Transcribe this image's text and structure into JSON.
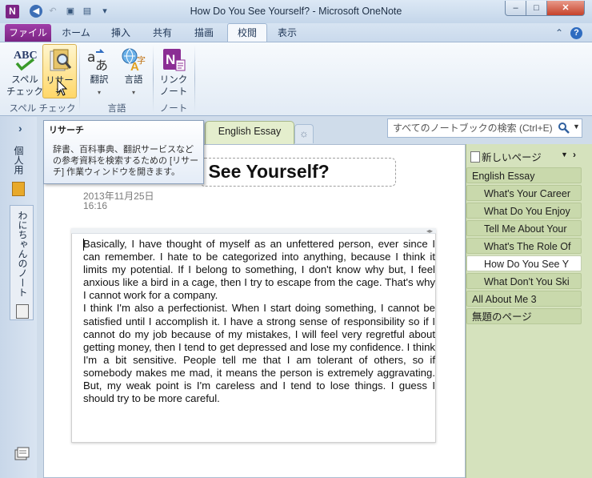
{
  "window": {
    "title": "How Do You See Yourself? - Microsoft OneNote",
    "app_icon": "N",
    "minimize": "–",
    "maximize": "□",
    "close": "✕"
  },
  "quick_access": {
    "back_icon": "◀",
    "undo_icon": "↶",
    "dock_icon": "▣",
    "page_icon": "▤",
    "customize_icon": "▾"
  },
  "tabs": [
    "ファイル",
    "ホーム",
    "挿入",
    "共有",
    "描画",
    "校閲",
    "表示"
  ],
  "active_tab": "校閲",
  "ribbon_right": {
    "up_icon": "⌃",
    "help_icon": "?"
  },
  "ribbon": {
    "spelling_label_1": "スペル",
    "spelling_label_2": "チェック",
    "research_label": "リサーチ",
    "translate_label": "翻訳",
    "language_label": "言語",
    "link_label_1": "リンク",
    "link_label_2": "ノート",
    "group_spelling_1": "スペル",
    "group_spelling_2": "チェック",
    "group_language": "言語",
    "group_notes": "ノート"
  },
  "tooltip": {
    "title": "リサーチ",
    "body": "辞書、百科事典、翻訳サービスなどの参考資料を検索するための [リサーチ] 作業ウィンドウを開きます。"
  },
  "left_nav": {
    "expand_icon": "›",
    "notebook_1": "個人用",
    "notebook_2": "わにちゃんのノート"
  },
  "section_tab": "English Essay",
  "new_section_icon": "☼",
  "search": {
    "placeholder": "すべてのノートブックの検索 (Ctrl+E)"
  },
  "pages_panel": {
    "new_page": "新しいページ",
    "items": [
      {
        "label": "English Essay",
        "level": "top"
      },
      {
        "label": "What's Your Career",
        "level": "sub"
      },
      {
        "label": "What Do You Enjoy",
        "level": "sub"
      },
      {
        "label": "Tell Me About Your",
        "level": "sub"
      },
      {
        "label": "What's The Role Of",
        "level": "sub"
      },
      {
        "label": "How Do You See Y",
        "level": "sub",
        "selected": true
      },
      {
        "label": "What Don't You Ski",
        "level": "sub"
      },
      {
        "label": "All About Me 3",
        "level": "top"
      },
      {
        "label": "無題のページ",
        "level": "top"
      }
    ]
  },
  "page": {
    "title": "u See Yourself?",
    "date": "2013年11月25日",
    "time": "16:16",
    "body": "Basically, I have thought of myself as an unfettered person, ever since I can remember.  I hate to be categorized into anything, because I think it limits my potential. If I belong to something, I don't know why but, I feel anxious like a bird in a cage, then I try to escape from the cage. That's why I cannot work for a company.\nI think I'm also a perfectionist. When I start doing something, I cannot be satisfied until I accomplish it. I have a strong sense of responsibility so if I cannot do my job because of my mistakes, I will feel very regretful about getting money, then I tend to get depressed and lose my confidence. I think I'm a bit sensitive. People tell me that I am tolerant of others, so if somebody makes me mad, it means the person is extremely aggravating. But, my weak point is I'm careless and I tend to lose things. I guess I should try to be more careful."
  },
  "colors": {
    "file_tab": "#8b2e94",
    "section": "#d5e2bd",
    "window": "#cfdcea"
  }
}
